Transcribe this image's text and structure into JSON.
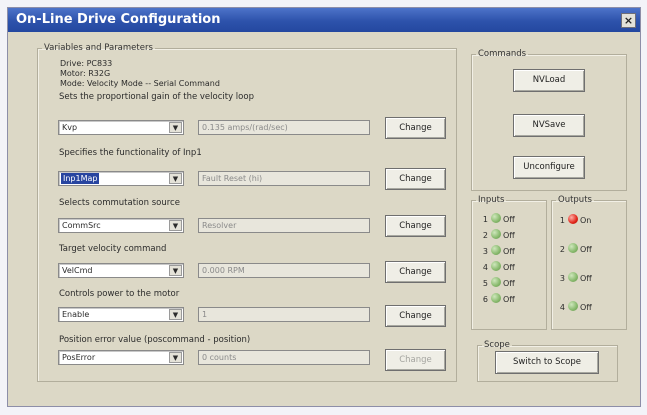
{
  "window": {
    "title": "On-Line Drive Configuration",
    "close_glyph": "×"
  },
  "variables": {
    "legend": "Variables and Parameters",
    "drive": "Drive: PC833",
    "motor": "Motor: R32G",
    "mode": "Mode: Velocity Mode -- Serial Command",
    "params": [
      {
        "description": "Sets the proportional gain of the velocity loop",
        "select_value": "Kvp",
        "field_value": "0.135 amps/(rad/sec)",
        "button_label": "Change",
        "button_enabled": true
      },
      {
        "description": "Specifies the functionality of Inp1",
        "select_value": "Inp1Map",
        "field_value": "Fault Reset (hi)",
        "button_label": "Change",
        "button_enabled": true
      },
      {
        "description": "Selects commutation source",
        "select_value": "CommSrc",
        "field_value": "Resolver",
        "button_label": "Change",
        "button_enabled": true
      },
      {
        "description": "Target velocity command",
        "select_value": "VelCmd",
        "field_value": "0.000 RPM",
        "button_label": "Change",
        "button_enabled": true
      },
      {
        "description": "Controls power to the motor",
        "select_value": "Enable",
        "field_value": "1",
        "button_label": "Change",
        "button_enabled": true
      },
      {
        "description": "Position error value (poscommand - position)",
        "select_value": "PosError",
        "field_value": "0 counts",
        "button_label": "Change",
        "button_enabled": false
      }
    ]
  },
  "commands": {
    "legend": "Commands",
    "nvload_label": "NVLoad",
    "nvsave_label": "NVSave",
    "unconfigure_label": "Unconfigure"
  },
  "inputs": {
    "legend": "Inputs",
    "items": [
      {
        "num": "1",
        "state": "Off"
      },
      {
        "num": "2",
        "state": "Off"
      },
      {
        "num": "3",
        "state": "Off"
      },
      {
        "num": "4",
        "state": "Off"
      },
      {
        "num": "5",
        "state": "Off"
      },
      {
        "num": "6",
        "state": "Off"
      }
    ]
  },
  "outputs": {
    "legend": "Outputs",
    "items": [
      {
        "num": "1",
        "state": "On",
        "color": "#e02418"
      },
      {
        "num": "2",
        "state": "Off",
        "color": "#86b86b"
      },
      {
        "num": "3",
        "state": "Off",
        "color": "#86b86b"
      },
      {
        "num": "4",
        "state": "Off",
        "color": "#86b86b"
      }
    ]
  },
  "scope": {
    "legend": "Scope",
    "button_label": "Switch to Scope"
  }
}
